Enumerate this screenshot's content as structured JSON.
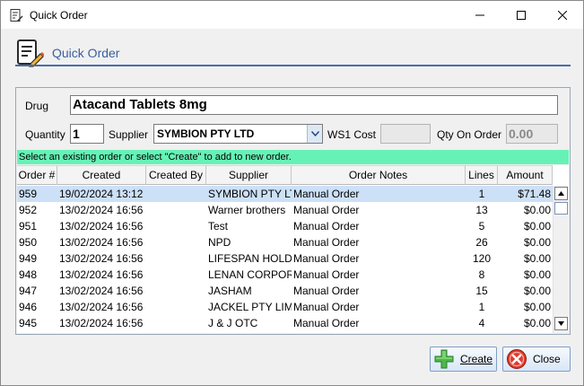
{
  "window": {
    "title": "Quick Order"
  },
  "header": {
    "title": "Quick Order"
  },
  "form": {
    "drug_label": "Drug",
    "drug_value": "Atacand Tablets 8mg",
    "quantity_label": "Quantity",
    "quantity_value": "1",
    "supplier_label": "Supplier",
    "supplier_value": "SYMBION PTY LTD",
    "ws1_cost_label": "WS1 Cost",
    "ws1_cost_value": "",
    "qty_on_order_label": "Qty On Order",
    "qty_on_order_value": "0.00"
  },
  "hint": "Select an existing order or select \"Create\" to add to new order.",
  "table": {
    "columns": [
      "Order #",
      "Created",
      "Created By",
      "Supplier",
      "Order Notes",
      "Lines",
      "Amount"
    ],
    "rows": [
      [
        "959",
        "19/02/2024 13:12",
        "",
        "SYMBION PTY LTD",
        "Manual Order",
        "1",
        "$71.48"
      ],
      [
        "952",
        "13/02/2024 16:56",
        "",
        "Warner brothers",
        "Manual Order",
        "13",
        "$0.00"
      ],
      [
        "951",
        "13/02/2024 16:56",
        "",
        "Test",
        "Manual Order",
        "5",
        "$0.00"
      ],
      [
        "950",
        "13/02/2024 16:56",
        "",
        "NPD",
        "Manual Order",
        "26",
        "$0.00"
      ],
      [
        "949",
        "13/02/2024 16:56",
        "",
        "LIFESPAN HOLDINGS",
        "Manual Order",
        "120",
        "$0.00"
      ],
      [
        "948",
        "13/02/2024 16:56",
        "",
        "LENAN CORPORATION",
        "Manual Order",
        "8",
        "$0.00"
      ],
      [
        "947",
        "13/02/2024 16:56",
        "",
        "JASHAM",
        "Manual Order",
        "15",
        "$0.00"
      ],
      [
        "946",
        "13/02/2024 16:56",
        "",
        "JACKEL PTY LIMITED",
        "Manual Order",
        "1",
        "$0.00"
      ],
      [
        "945",
        "13/02/2024 16:56",
        "",
        "J & J OTC",
        "Manual Order",
        "4",
        "$0.00"
      ]
    ],
    "selected_row": 0
  },
  "buttons": {
    "create_label": "Create",
    "close_label": "Close"
  },
  "colors": {
    "hint_bar": "#66f2b6",
    "selected_row": "#cce0f7",
    "header_title": "#3a5f9e"
  },
  "icons": {
    "app": "notepad-pencil-icon",
    "header": "notepad-pencil-icon",
    "create": "plus-icon",
    "close": "close-circle-icon"
  }
}
